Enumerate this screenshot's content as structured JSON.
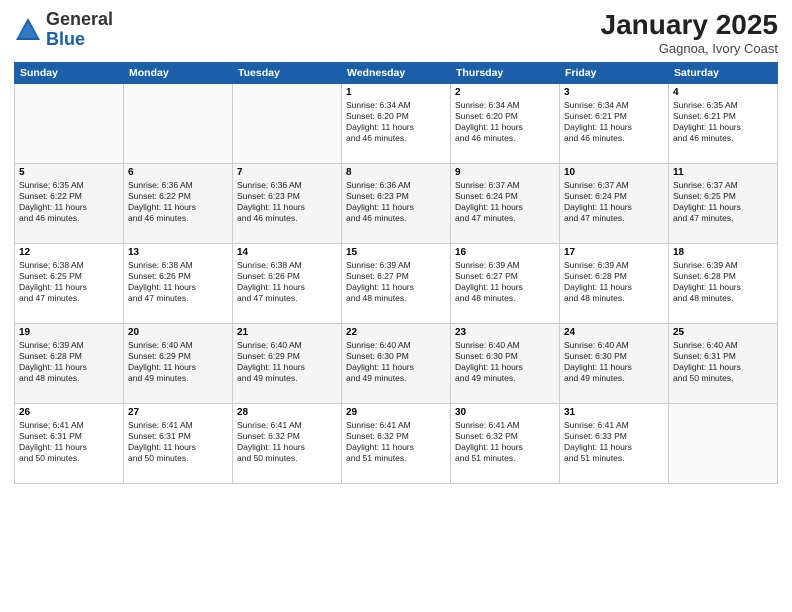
{
  "header": {
    "logo_general": "General",
    "logo_blue": "Blue",
    "month": "January 2025",
    "location": "Gagnoa, Ivory Coast"
  },
  "weekdays": [
    "Sunday",
    "Monday",
    "Tuesday",
    "Wednesday",
    "Thursday",
    "Friday",
    "Saturday"
  ],
  "weeks": [
    [
      {
        "day": "",
        "info": ""
      },
      {
        "day": "",
        "info": ""
      },
      {
        "day": "",
        "info": ""
      },
      {
        "day": "1",
        "info": "Sunrise: 6:34 AM\nSunset: 6:20 PM\nDaylight: 11 hours\nand 46 minutes."
      },
      {
        "day": "2",
        "info": "Sunrise: 6:34 AM\nSunset: 6:20 PM\nDaylight: 11 hours\nand 46 minutes."
      },
      {
        "day": "3",
        "info": "Sunrise: 6:34 AM\nSunset: 6:21 PM\nDaylight: 11 hours\nand 46 minutes."
      },
      {
        "day": "4",
        "info": "Sunrise: 6:35 AM\nSunset: 6:21 PM\nDaylight: 11 hours\nand 46 minutes."
      }
    ],
    [
      {
        "day": "5",
        "info": "Sunrise: 6:35 AM\nSunset: 6:22 PM\nDaylight: 11 hours\nand 46 minutes."
      },
      {
        "day": "6",
        "info": "Sunrise: 6:36 AM\nSunset: 6:22 PM\nDaylight: 11 hours\nand 46 minutes."
      },
      {
        "day": "7",
        "info": "Sunrise: 6:36 AM\nSunset: 6:23 PM\nDaylight: 11 hours\nand 46 minutes."
      },
      {
        "day": "8",
        "info": "Sunrise: 6:36 AM\nSunset: 6:23 PM\nDaylight: 11 hours\nand 46 minutes."
      },
      {
        "day": "9",
        "info": "Sunrise: 6:37 AM\nSunset: 6:24 PM\nDaylight: 11 hours\nand 47 minutes."
      },
      {
        "day": "10",
        "info": "Sunrise: 6:37 AM\nSunset: 6:24 PM\nDaylight: 11 hours\nand 47 minutes."
      },
      {
        "day": "11",
        "info": "Sunrise: 6:37 AM\nSunset: 6:25 PM\nDaylight: 11 hours\nand 47 minutes."
      }
    ],
    [
      {
        "day": "12",
        "info": "Sunrise: 6:38 AM\nSunset: 6:25 PM\nDaylight: 11 hours\nand 47 minutes."
      },
      {
        "day": "13",
        "info": "Sunrise: 6:38 AM\nSunset: 6:26 PM\nDaylight: 11 hours\nand 47 minutes."
      },
      {
        "day": "14",
        "info": "Sunrise: 6:38 AM\nSunset: 6:26 PM\nDaylight: 11 hours\nand 47 minutes."
      },
      {
        "day": "15",
        "info": "Sunrise: 6:39 AM\nSunset: 6:27 PM\nDaylight: 11 hours\nand 48 minutes."
      },
      {
        "day": "16",
        "info": "Sunrise: 6:39 AM\nSunset: 6:27 PM\nDaylight: 11 hours\nand 48 minutes."
      },
      {
        "day": "17",
        "info": "Sunrise: 6:39 AM\nSunset: 6:28 PM\nDaylight: 11 hours\nand 48 minutes."
      },
      {
        "day": "18",
        "info": "Sunrise: 6:39 AM\nSunset: 6:28 PM\nDaylight: 11 hours\nand 48 minutes."
      }
    ],
    [
      {
        "day": "19",
        "info": "Sunrise: 6:39 AM\nSunset: 6:28 PM\nDaylight: 11 hours\nand 48 minutes."
      },
      {
        "day": "20",
        "info": "Sunrise: 6:40 AM\nSunset: 6:29 PM\nDaylight: 11 hours\nand 49 minutes."
      },
      {
        "day": "21",
        "info": "Sunrise: 6:40 AM\nSunset: 6:29 PM\nDaylight: 11 hours\nand 49 minutes."
      },
      {
        "day": "22",
        "info": "Sunrise: 6:40 AM\nSunset: 6:30 PM\nDaylight: 11 hours\nand 49 minutes."
      },
      {
        "day": "23",
        "info": "Sunrise: 6:40 AM\nSunset: 6:30 PM\nDaylight: 11 hours\nand 49 minutes."
      },
      {
        "day": "24",
        "info": "Sunrise: 6:40 AM\nSunset: 6:30 PM\nDaylight: 11 hours\nand 49 minutes."
      },
      {
        "day": "25",
        "info": "Sunrise: 6:40 AM\nSunset: 6:31 PM\nDaylight: 11 hours\nand 50 minutes."
      }
    ],
    [
      {
        "day": "26",
        "info": "Sunrise: 6:41 AM\nSunset: 6:31 PM\nDaylight: 11 hours\nand 50 minutes."
      },
      {
        "day": "27",
        "info": "Sunrise: 6:41 AM\nSunset: 6:31 PM\nDaylight: 11 hours\nand 50 minutes."
      },
      {
        "day": "28",
        "info": "Sunrise: 6:41 AM\nSunset: 6:32 PM\nDaylight: 11 hours\nand 50 minutes."
      },
      {
        "day": "29",
        "info": "Sunrise: 6:41 AM\nSunset: 6:32 PM\nDaylight: 11 hours\nand 51 minutes."
      },
      {
        "day": "30",
        "info": "Sunrise: 6:41 AM\nSunset: 6:32 PM\nDaylight: 11 hours\nand 51 minutes."
      },
      {
        "day": "31",
        "info": "Sunrise: 6:41 AM\nSunset: 6:33 PM\nDaylight: 11 hours\nand 51 minutes."
      },
      {
        "day": "",
        "info": ""
      }
    ]
  ]
}
